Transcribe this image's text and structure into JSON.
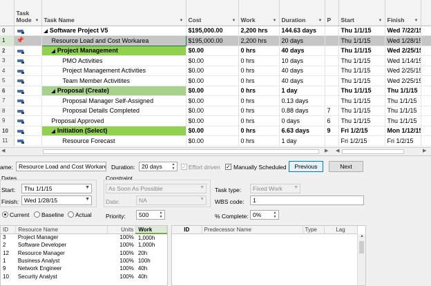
{
  "columns": {
    "mode": "Task Mode",
    "name": "Task Name",
    "cost": "Cost",
    "work": "Work",
    "duration": "Duration",
    "pred": "P",
    "start": "Start",
    "finish": "Finish"
  },
  "rows": [
    {
      "n": "0",
      "name": "Software Project V5",
      "cost": "$195,000.00",
      "work": "2,200 hrs",
      "dur": "144.63 days",
      "pred": "",
      "start": "Thu 1/1/15",
      "finish": "Wed 7/22/15",
      "style": "project",
      "indent": 0,
      "tri": "◢",
      "icon": "auto-schedule-icon"
    },
    {
      "n": "1",
      "name": "Resource Load and Cost Workarea",
      "cost": "$195,000.00",
      "work": "2,200 hrs",
      "dur": "20 days",
      "pred": "",
      "start": "Thu 1/1/15",
      "finish": "Wed 1/28/15",
      "style": "selected",
      "indent": 1,
      "tri": "",
      "icon": "manual-schedule-pin-icon"
    },
    {
      "n": "2",
      "name": "Project Management",
      "cost": "$0.00",
      "work": "0 hrs",
      "dur": "40 days",
      "pred": "",
      "start": "Thu 1/1/15",
      "finish": "Wed 2/25/15",
      "style": "green",
      "indent": 1,
      "tri": "◢",
      "icon": "auto-schedule-icon"
    },
    {
      "n": "3",
      "name": "PMO Activities",
      "cost": "$0.00",
      "work": "0 hrs",
      "dur": "10 days",
      "pred": "",
      "start": "Thu 1/1/15",
      "finish": "Wed 1/14/15",
      "style": "",
      "indent": 2,
      "tri": "",
      "icon": "auto-schedule-icon"
    },
    {
      "n": "4",
      "name": "Project Management Activities",
      "cost": "$0.00",
      "work": "0 hrs",
      "dur": "40 days",
      "pred": "",
      "start": "Thu 1/1/15",
      "finish": "Wed 2/25/15",
      "style": "",
      "indent": 2,
      "tri": "",
      "icon": "auto-schedule-icon"
    },
    {
      "n": "5",
      "name": "Team Member Activitites",
      "cost": "$0.00",
      "work": "0 hrs",
      "dur": "40 days",
      "pred": "",
      "start": "Thu 1/1/15",
      "finish": "Wed 2/25/15",
      "style": "",
      "indent": 2,
      "tri": "",
      "icon": "auto-schedule-icon"
    },
    {
      "n": "6",
      "name": "Proposal (Create)",
      "cost": "$0.00",
      "work": "0 hrs",
      "dur": "1 day",
      "pred": "",
      "start": "Thu 1/1/15",
      "finish": "Thu 1/1/15",
      "style": "lgreen",
      "indent": 1,
      "tri": "◢",
      "icon": "auto-schedule-icon"
    },
    {
      "n": "7",
      "name": "Proposal Manager Self-Assigned",
      "cost": "$0.00",
      "work": "0 hrs",
      "dur": "0.13 days",
      "pred": "",
      "start": "Thu 1/1/15",
      "finish": "Thu 1/1/15",
      "style": "",
      "indent": 2,
      "tri": "",
      "icon": "auto-schedule-icon"
    },
    {
      "n": "8",
      "name": "Proposal Details Completed",
      "cost": "$0.00",
      "work": "0 hrs",
      "dur": "0.88 days",
      "pred": "7",
      "start": "Thu 1/1/15",
      "finish": "Thu 1/1/15",
      "style": "",
      "indent": 2,
      "tri": "",
      "icon": "auto-schedule-icon"
    },
    {
      "n": "9",
      "name": "Proposal Approved",
      "cost": "$0.00",
      "work": "0 hrs",
      "dur": "0 days",
      "pred": "6",
      "start": "Thu 1/1/15",
      "finish": "Thu 1/1/15",
      "style": "",
      "indent": 1,
      "tri": "",
      "icon": "auto-schedule-icon"
    },
    {
      "n": "10",
      "name": "Initiation (Select)",
      "cost": "$0.00",
      "work": "0 hrs",
      "dur": "6.63 days",
      "pred": "9",
      "start": "Fri 1/2/15",
      "finish": "Mon 1/12/15",
      "style": "green",
      "indent": 1,
      "tri": "◢",
      "icon": "auto-schedule-icon"
    },
    {
      "n": "11",
      "name": "Resource Forecast",
      "cost": "$0.00",
      "work": "0 hrs",
      "dur": "1 day",
      "pred": "",
      "start": "Fri 1/2/15",
      "finish": "Fri 1/2/15",
      "style": "",
      "indent": 2,
      "tri": "",
      "icon": "auto-schedule-icon"
    }
  ],
  "form": {
    "name_label": "ame:",
    "name_value": "Resource Load and Cost Workarea",
    "duration_label": "Duration:",
    "duration_value": "20 days",
    "effort_label": "Effort driven",
    "manual_label": "Manually Scheduled",
    "previous": "Previous",
    "next": "Next",
    "dates_label": "Dates",
    "start_label": "Start:",
    "start_value": "Thu 1/1/15",
    "finish_label": "Finish:",
    "finish_value": "Wed 1/28/15",
    "constraint_label": "Constraint",
    "constraint_value": "As Soon As Possible",
    "date_label": "Date:",
    "date_value": "NA",
    "tasktype_label": "Task type:",
    "tasktype_value": "Fixed Work",
    "wbs_label": "WBS code:",
    "wbs_value": "1",
    "current": "Current",
    "baseline": "Baseline",
    "actual": "Actual",
    "priority_label": "Priority:",
    "priority_value": "500",
    "complete_label": "% Complete:",
    "complete_value": "0%"
  },
  "resources": {
    "headers": {
      "id": "ID",
      "name": "Resource Name",
      "units": "Units",
      "work": "Work"
    },
    "rows": [
      {
        "id": "3",
        "name": "Project Manager",
        "units": "100%",
        "work": "1,000h"
      },
      {
        "id": "2",
        "name": "Software Developer",
        "units": "100%",
        "work": "1,000h"
      },
      {
        "id": "12",
        "name": "Resource Manager",
        "units": "100%",
        "work": "20h"
      },
      {
        "id": "1",
        "name": "Business Analyst",
        "units": "100%",
        "work": "100h"
      },
      {
        "id": "9",
        "name": "Network Engineer",
        "units": "100%",
        "work": "40h"
      },
      {
        "id": "10",
        "name": "Security Analyst",
        "units": "100%",
        "work": "40h"
      }
    ]
  },
  "predecessors": {
    "headers": {
      "id": "ID",
      "name": "Predecessor Name",
      "type": "Type",
      "lag": "Lag"
    }
  }
}
